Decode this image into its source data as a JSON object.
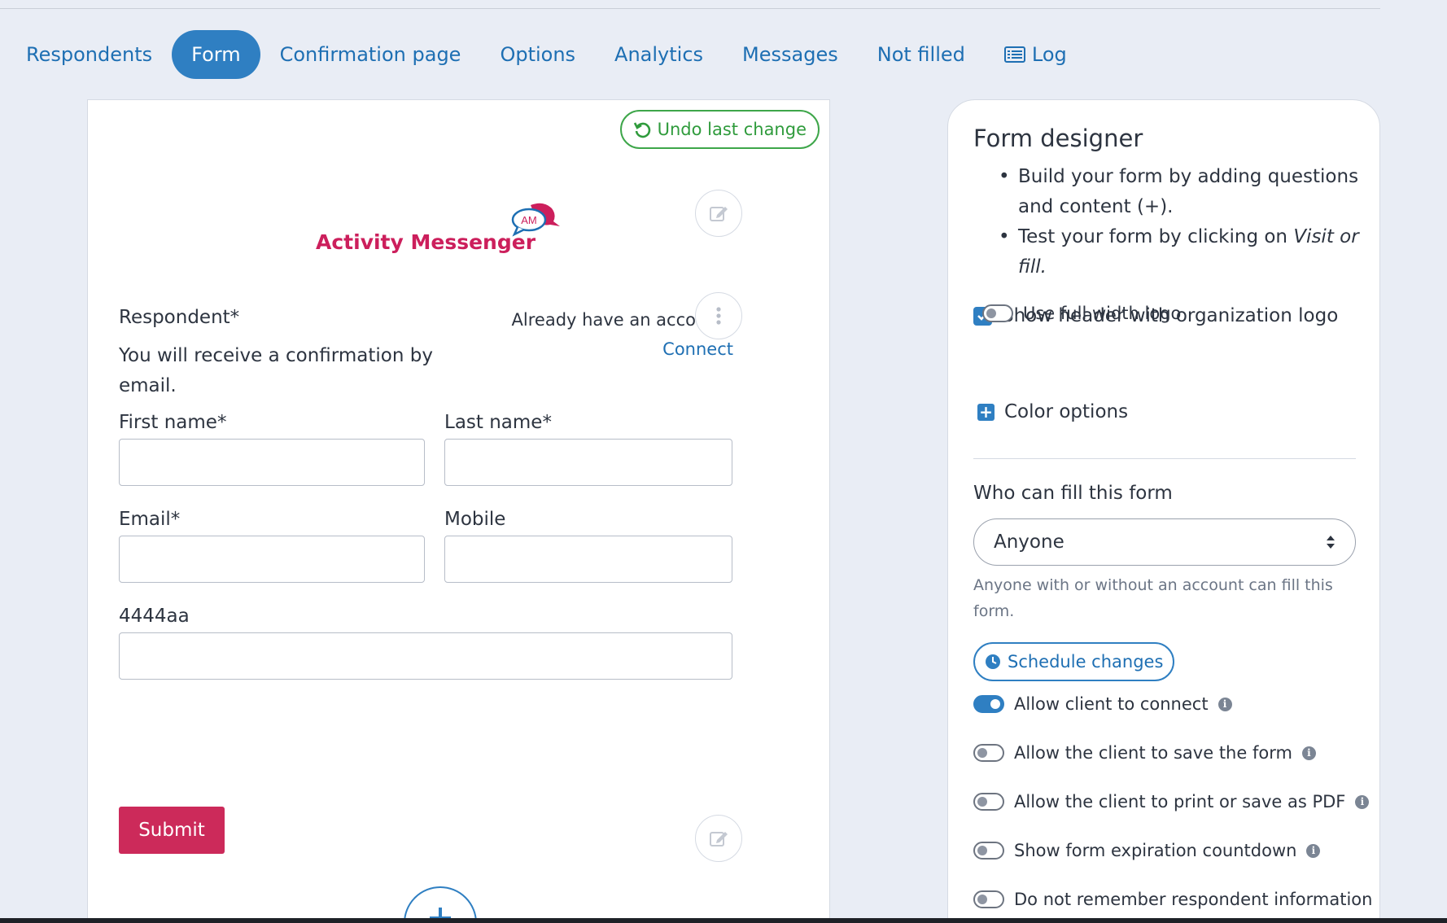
{
  "tabs": [
    {
      "label": "Respondents",
      "active": false
    },
    {
      "label": "Form",
      "active": true
    },
    {
      "label": "Confirmation page",
      "active": false
    },
    {
      "label": "Options",
      "active": false
    },
    {
      "label": "Analytics",
      "active": false
    },
    {
      "label": "Messages",
      "active": false
    },
    {
      "label": "Not filled",
      "active": false
    },
    {
      "label": "Log",
      "active": false,
      "icon": "list-icon"
    }
  ],
  "form": {
    "undo_label": "Undo last change",
    "logo_text": "Activity Messenger",
    "logo_badge": "AM",
    "respondent_title": "Respondent*",
    "respondent_desc": "You will receive a confirmation by email.",
    "already_account": "Already have an account?",
    "connect_label": "Connect",
    "fields": {
      "first_name": "First name*",
      "last_name": "Last name*",
      "email": "Email*",
      "mobile": "Mobile",
      "custom": "4444aa"
    },
    "submit_label": "Submit"
  },
  "designer": {
    "title": "Form designer",
    "bullet1": "Build your form by adding questions and content (+).",
    "bullet2_prefix": "Test your form by clicking on ",
    "bullet2_em": "Visit or fill.",
    "show_header_label": "Show header with organization logo",
    "show_header_checked": true,
    "full_width_label": "Use full width logo",
    "full_width_on": false,
    "color_options_label": "Color options",
    "who_label": "Who can fill this form",
    "who_value": "Anyone",
    "who_help": "Anyone with or without an account can fill this form.",
    "schedule_label": "Schedule changes",
    "toggles": [
      {
        "label": "Allow client to connect",
        "on": true
      },
      {
        "label": "Allow the client to save the form",
        "on": false
      },
      {
        "label": "Allow the client to print or save as PDF",
        "on": false
      },
      {
        "label": "Show form expiration countdown",
        "on": false
      },
      {
        "label": "Do not remember respondent information",
        "on": false
      }
    ]
  },
  "colors": {
    "accent": "#2f7fc2",
    "brand": "#cc1f5c",
    "undo": "#3ea64a",
    "submit": "#cc2a5a"
  }
}
